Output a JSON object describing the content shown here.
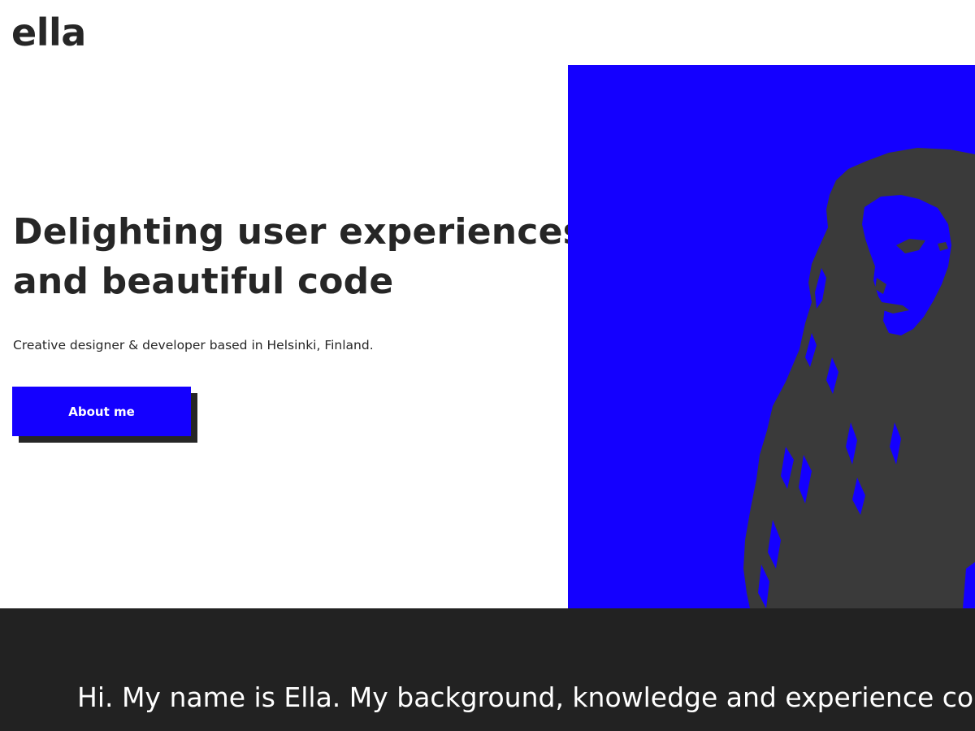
{
  "header": {
    "logo_text": "ella"
  },
  "hero": {
    "title_line_1": "Delighting user experiences",
    "title_line_2": "and beautiful code",
    "subtitle": "Creative designer & developer based in Helsinki, Finland.",
    "cta_label": "About me",
    "image_alt": "Duotone portrait of a woman with long hair"
  },
  "intro": {
    "text": "Hi. My name is Ella. My background, knowledge and experience cons"
  },
  "colors": {
    "accent_blue": "#1400ff",
    "dark": "#262626",
    "footer_bg": "#222222",
    "white": "#ffffff"
  }
}
